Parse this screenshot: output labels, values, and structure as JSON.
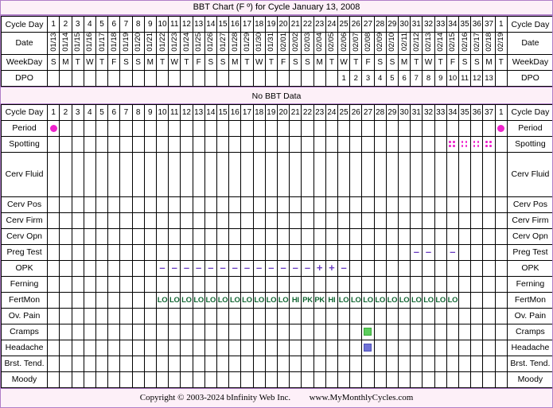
{
  "title": "BBT Chart (F º) for Cycle January 13, 2008",
  "no_bbt_message": "No BBT Data",
  "labels": {
    "cycle_day": "Cycle Day",
    "date": "Date",
    "weekday": "WeekDay",
    "dpo": "DPO",
    "period": "Period",
    "spotting": "Spotting",
    "cerv_fluid": "Cerv Fluid",
    "cerv_pos": "Cerv Pos",
    "cerv_firm": "Cerv Firm",
    "cerv_opn": "Cerv Opn",
    "preg_test": "Preg Test",
    "opk": "OPK",
    "ferning": "Ferning",
    "fertmon": "FertMon",
    "ov_pain": "Ov. Pain",
    "cramps": "Cramps",
    "headache": "Headache",
    "brst_tend": "Brst. Tend.",
    "moody": "Moody"
  },
  "colors": {
    "period": "#ee22cc",
    "spotting": "#ee22cc",
    "opk": "#6a3ec0",
    "preg_test": "#6a3ec0",
    "fertmon": "#116633",
    "cramps": "#5cce5c",
    "headache": "#6f72d6",
    "border_accent": "#b07ec8",
    "panel_bg": "#fdf0f8",
    "header_bg": "#efefef",
    "date_bg": "#f7f3e4"
  },
  "chart_data": {
    "type": "table",
    "title": "BBT Chart (F º) for Cycle January 13, 2008",
    "cycle_start_date": "01/13",
    "cycle_end_date": "02/19",
    "cycle_days": [
      1,
      2,
      3,
      4,
      5,
      6,
      7,
      8,
      9,
      10,
      11,
      12,
      13,
      14,
      15,
      16,
      17,
      18,
      19,
      20,
      21,
      22,
      23,
      24,
      25,
      26,
      27,
      28,
      29,
      30,
      31,
      32,
      33,
      34,
      35,
      36,
      37,
      1
    ],
    "dates": [
      "01/13",
      "01/14",
      "01/15",
      "01/16",
      "01/17",
      "01/18",
      "01/19",
      "01/20",
      "01/21",
      "01/22",
      "01/23",
      "01/24",
      "01/25",
      "01/26",
      "01/27",
      "01/28",
      "01/29",
      "01/30",
      "01/31",
      "02/01",
      "02/02",
      "02/03",
      "02/04",
      "02/05",
      "02/06",
      "02/07",
      "02/08",
      "02/09",
      "02/10",
      "02/11",
      "02/12",
      "02/13",
      "02/14",
      "02/15",
      "02/16",
      "02/17",
      "02/18",
      "02/19"
    ],
    "weekdays": [
      "S",
      "M",
      "T",
      "W",
      "T",
      "F",
      "S",
      "S",
      "M",
      "T",
      "W",
      "T",
      "F",
      "S",
      "S",
      "M",
      "T",
      "W",
      "T",
      "F",
      "S",
      "S",
      "M",
      "T",
      "W",
      "T",
      "F",
      "S",
      "S",
      "M",
      "T",
      "W",
      "T",
      "F",
      "S",
      "S",
      "M",
      "T"
    ],
    "dpo": [
      "",
      "",
      "",
      "",
      "",
      "",
      "",
      "",
      "",
      "",
      "",
      "",
      "",
      "",
      "",
      "",
      "",
      "",
      "",
      "",
      "",
      "",
      "",
      "",
      "1",
      "2",
      "3",
      "4",
      "5",
      "6",
      "7",
      "8",
      "9",
      "10",
      "11",
      "12",
      "13",
      ""
    ],
    "period": [
      "P",
      "",
      "",
      "",
      "",
      "",
      "",
      "",
      "",
      "",
      "",
      "",
      "",
      "",
      "",
      "",
      "",
      "",
      "",
      "",
      "",
      "",
      "",
      "",
      "",
      "",
      "",
      "",
      "",
      "",
      "",
      "",
      "",
      "",
      "",
      "",
      "",
      "P"
    ],
    "spotting": [
      "",
      "",
      "",
      "",
      "",
      "",
      "",
      "",
      "",
      "",
      "",
      "",
      "",
      "",
      "",
      "",
      "",
      "",
      "",
      "",
      "",
      "",
      "",
      "",
      "",
      "",
      "",
      "",
      "",
      "",
      "",
      "",
      "",
      "S",
      "S",
      "S",
      "S",
      ""
    ],
    "cerv_fluid": [
      "",
      "",
      "",
      "",
      "",
      "",
      "",
      "",
      "",
      "",
      "",
      "",
      "",
      "",
      "",
      "",
      "",
      "",
      "",
      "",
      "",
      "",
      "",
      "",
      "",
      "",
      "",
      "",
      "",
      "",
      "",
      "",
      "",
      "",
      "",
      "",
      "",
      ""
    ],
    "cerv_pos": [
      "",
      "",
      "",
      "",
      "",
      "",
      "",
      "",
      "",
      "",
      "",
      "",
      "",
      "",
      "",
      "",
      "",
      "",
      "",
      "",
      "",
      "",
      "",
      "",
      "",
      "",
      "",
      "",
      "",
      "",
      "",
      "",
      "",
      "",
      "",
      "",
      "",
      ""
    ],
    "cerv_firm": [
      "",
      "",
      "",
      "",
      "",
      "",
      "",
      "",
      "",
      "",
      "",
      "",
      "",
      "",
      "",
      "",
      "",
      "",
      "",
      "",
      "",
      "",
      "",
      "",
      "",
      "",
      "",
      "",
      "",
      "",
      "",
      "",
      "",
      "",
      "",
      "",
      "",
      ""
    ],
    "cerv_opn": [
      "",
      "",
      "",
      "",
      "",
      "",
      "",
      "",
      "",
      "",
      "",
      "",
      "",
      "",
      "",
      "",
      "",
      "",
      "",
      "",
      "",
      "",
      "",
      "",
      "",
      "",
      "",
      "",
      "",
      "",
      "",
      "",
      "",
      "",
      "",
      "",
      "",
      ""
    ],
    "preg_test": [
      "",
      "",
      "",
      "",
      "",
      "",
      "",
      "",
      "",
      "",
      "",
      "",
      "",
      "",
      "",
      "",
      "",
      "",
      "",
      "",
      "",
      "",
      "",
      "",
      "",
      "",
      "",
      "",
      "",
      "",
      "-",
      "-",
      "",
      "-",
      "",
      "",
      "",
      ""
    ],
    "opk": [
      "",
      "",
      "",
      "",
      "",
      "",
      "",
      "",
      "",
      "-",
      "-",
      "-",
      "-",
      "-",
      "-",
      "-",
      "-",
      "-",
      "-",
      "-",
      "-",
      "-",
      "+",
      "+",
      "-",
      "",
      "",
      "",
      "",
      "",
      "",
      "",
      "",
      "",
      "",
      "",
      "",
      ""
    ],
    "ferning": [
      "",
      "",
      "",
      "",
      "",
      "",
      "",
      "",
      "",
      "",
      "",
      "",
      "",
      "",
      "",
      "",
      "",
      "",
      "",
      "",
      "",
      "",
      "",
      "",
      "",
      "",
      "",
      "",
      "",
      "",
      "",
      "",
      "",
      "",
      "",
      "",
      "",
      ""
    ],
    "fertmon": [
      "",
      "",
      "",
      "",
      "",
      "",
      "",
      "",
      "",
      "LO",
      "LO",
      "LO",
      "LO",
      "LO",
      "LO",
      "LO",
      "LO",
      "LO",
      "LO",
      "LO",
      "HI",
      "PK",
      "PK",
      "HI",
      "LO",
      "LO",
      "LO",
      "LO",
      "LO",
      "LO",
      "LO",
      "LO",
      "LO",
      "LO",
      "",
      "",
      "",
      ""
    ],
    "ov_pain": [
      "",
      "",
      "",
      "",
      "",
      "",
      "",
      "",
      "",
      "",
      "",
      "",
      "",
      "",
      "",
      "",
      "",
      "",
      "",
      "",
      "",
      "",
      "",
      "",
      "",
      "",
      "",
      "",
      "",
      "",
      "",
      "",
      "",
      "",
      "",
      "",
      "",
      ""
    ],
    "cramps": [
      "",
      "",
      "",
      "",
      "",
      "",
      "",
      "",
      "",
      "",
      "",
      "",
      "",
      "",
      "",
      "",
      "",
      "",
      "",
      "",
      "",
      "",
      "",
      "",
      "",
      "",
      "C",
      "",
      "",
      "",
      "",
      "",
      "",
      "",
      "",
      "",
      "",
      ""
    ],
    "headache": [
      "",
      "",
      "",
      "",
      "",
      "",
      "",
      "",
      "",
      "",
      "",
      "",
      "",
      "",
      "",
      "",
      "",
      "",
      "",
      "",
      "",
      "",
      "",
      "",
      "",
      "",
      "H",
      "",
      "",
      "",
      "",
      "",
      "",
      "",
      "",
      "",
      "",
      ""
    ],
    "brst_tend": [
      "",
      "",
      "",
      "",
      "",
      "",
      "",
      "",
      "",
      "",
      "",
      "",
      "",
      "",
      "",
      "",
      "",
      "",
      "",
      "",
      "",
      "",
      "",
      "",
      "",
      "",
      "",
      "",
      "",
      "",
      "",
      "",
      "",
      "",
      "",
      "",
      "",
      ""
    ],
    "moody": [
      "",
      "",
      "",
      "",
      "",
      "",
      "",
      "",
      "",
      "",
      "",
      "",
      "",
      "",
      "",
      "",
      "",
      "",
      "",
      "",
      "",
      "",
      "",
      "",
      "",
      "",
      "",
      "",
      "",
      "",
      "",
      "",
      "",
      "",
      "",
      "",
      "",
      ""
    ]
  },
  "footer": {
    "copyright": "Copyright © 2003-2024 bInfinity Web Inc.",
    "site": "www.MyMonthlyCycles.com"
  }
}
